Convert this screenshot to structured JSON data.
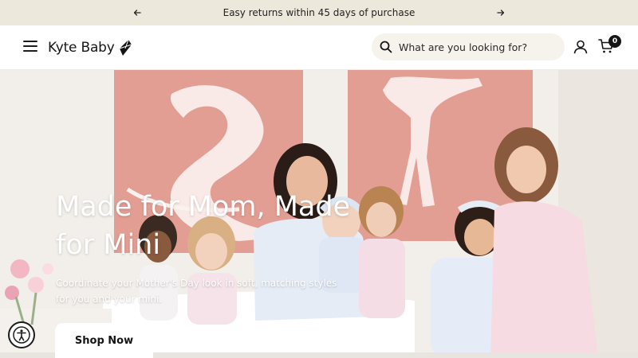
{
  "announcement": {
    "message": "Easy returns within 45 days of purchase",
    "prev_icon": "arrow-left-icon",
    "next_icon": "arrow-right-icon"
  },
  "header": {
    "menu_icon": "hamburger-menu-icon",
    "logo_text": "Kyte Baby",
    "logo_icon": "kite-icon",
    "search": {
      "placeholder": "What are you looking for?",
      "value": "",
      "icon": "search-icon"
    },
    "account_icon": "user-icon",
    "cart_icon": "cart-icon",
    "cart_count": "0"
  },
  "hero": {
    "title": "Made for Mom, Made for Mini",
    "subtitle": "Coordinate your Mother's Day look in soft, matching styles for you and your mini.",
    "cta_label": "Shop Now",
    "image_alt": "Mothers and children in matching pink and blue ballet-print pajamas"
  },
  "accessibility": {
    "icon": "accessibility-icon"
  },
  "colors": {
    "announcement_bg": "#ece8dc",
    "search_bg": "#f6f2ec",
    "hero_panel": "#e39e94",
    "text_dark": "#151515"
  }
}
